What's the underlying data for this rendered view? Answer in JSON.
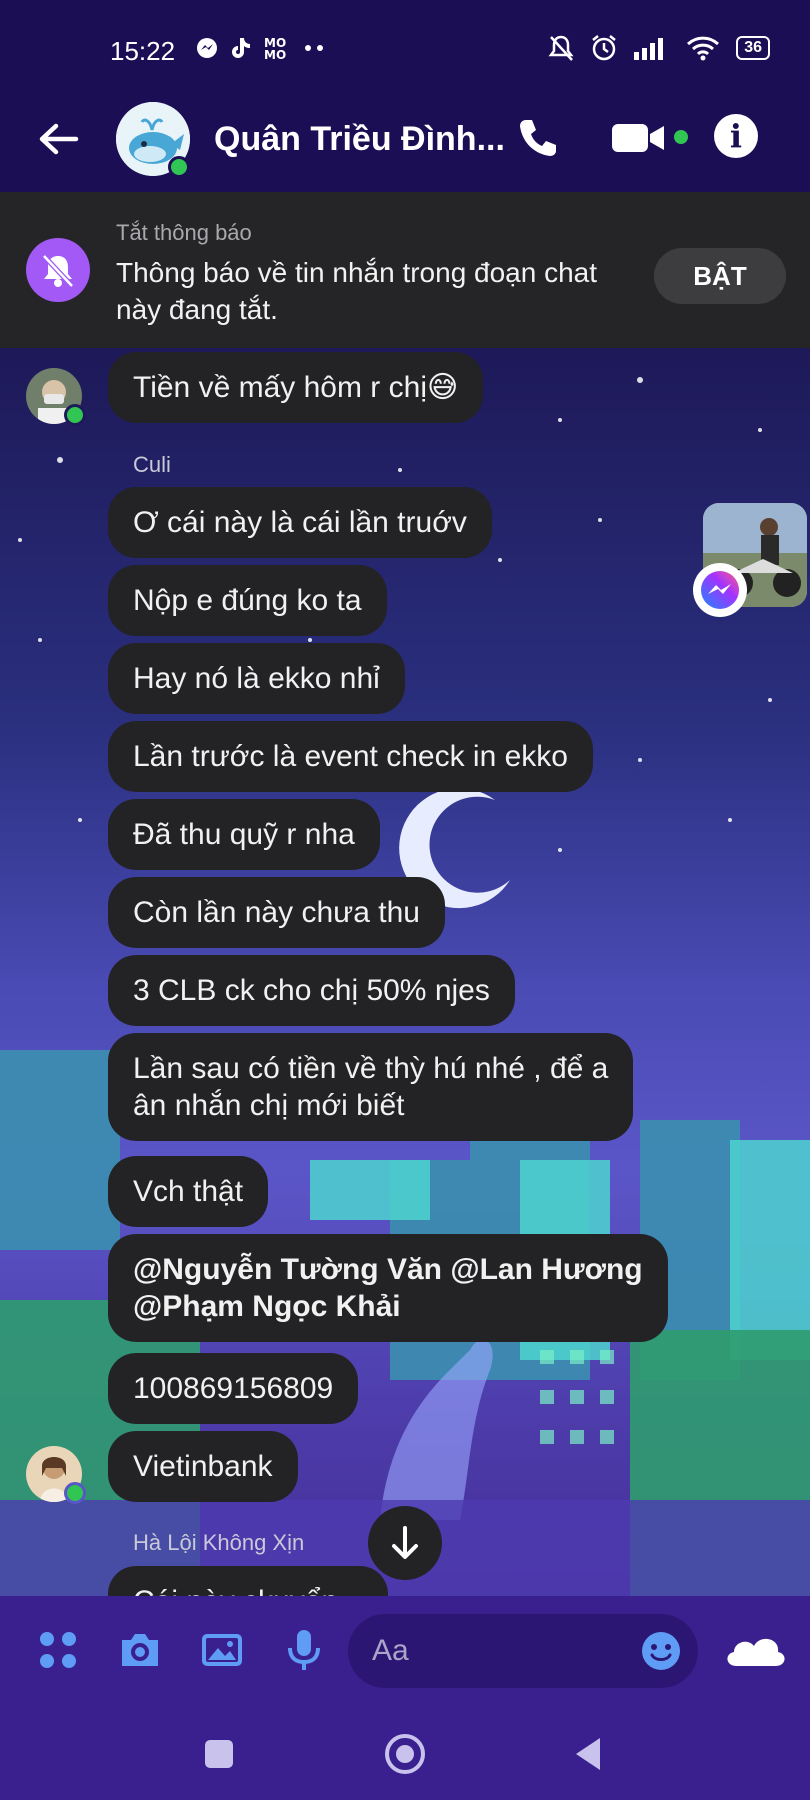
{
  "status_bar": {
    "time": "15:22",
    "battery": "36"
  },
  "header": {
    "chat_name": "Quân Triều Đình..."
  },
  "mute_banner": {
    "title": "Tắt thông báo",
    "text": "Thông báo về tin nhắn trong đoạn chat này đang tắt.",
    "button": "BẬT"
  },
  "messages": [
    {
      "sender": "",
      "text": "Tiền về mấy hôm r chị😅"
    },
    {
      "sender": "Culi",
      "text": "Ơ cái này là cái lần truớv"
    },
    {
      "sender": "",
      "text": "Nộp e đúng ko ta"
    },
    {
      "sender": "",
      "text": "Hay nó là ekko nhỉ"
    },
    {
      "sender": "",
      "text": "Lần trước là event check in ekko"
    },
    {
      "sender": "",
      "text": "Đã thu quỹ r nha"
    },
    {
      "sender": "",
      "text": "Còn lần này chưa thu"
    },
    {
      "sender": "",
      "text": "3 CLB ck cho chị 50% njes"
    },
    {
      "sender": "",
      "line1": "Lần sau có tiền về thỳ hú nhé , để a",
      "line2": "ân nhắn chị mới biết"
    },
    {
      "sender": "",
      "text": "Vch thật"
    },
    {
      "sender": "",
      "line1": "@Nguyễn Tường Văn @Lan Hương",
      "line2": "@Phạm Ngọc Khải"
    },
    {
      "sender": "",
      "text": "100869156809"
    },
    {
      "sender": "",
      "text": "Vietinbank"
    },
    {
      "sender": "Hà Lội Không Xịn",
      "text": "Cái này ckuyển..."
    }
  ],
  "composer": {
    "placeholder": "Aa"
  },
  "icons": {
    "back": "arrow-left-icon",
    "call": "phone-icon",
    "video": "video-camera-icon",
    "info": "info-icon",
    "muted_bell": "bell-off-icon",
    "apps": "four-dots-icon",
    "camera": "camera-icon",
    "gallery": "image-icon",
    "mic": "microphone-icon",
    "emoji": "smiley-icon",
    "cloud": "cloud-icon",
    "scroll_down": "arrow-down-icon",
    "nav_recent": "square-icon",
    "nav_home": "circle-icon",
    "nav_back": "triangle-back-icon"
  },
  "colors": {
    "header_bg": "#1b0e55",
    "bubble_bg": "#232325",
    "accent_purple": "#a259f5",
    "online_green": "#31c553",
    "composer_bg": "#3a1f8e",
    "icon_blue": "#5e9cf5"
  }
}
